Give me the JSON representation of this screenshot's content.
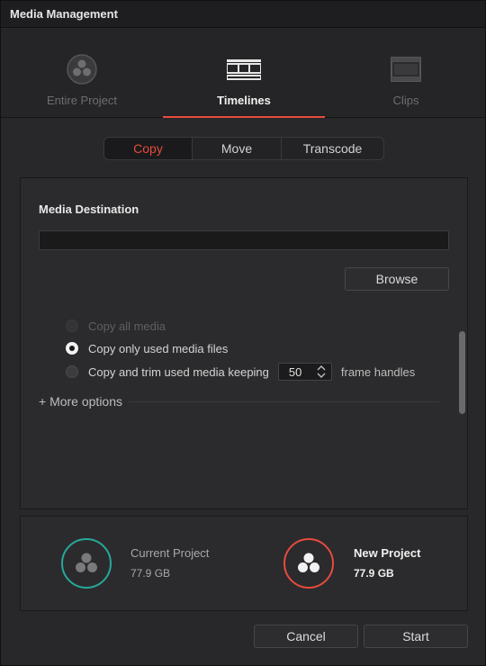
{
  "window": {
    "title": "Media Management"
  },
  "modes": [
    {
      "label": "Entire Project",
      "icon": "resolve-logo-icon",
      "active": false
    },
    {
      "label": "Timelines",
      "icon": "timeline-icon",
      "active": true
    },
    {
      "label": "Clips",
      "icon": "film-strip-icon",
      "active": false
    }
  ],
  "operations": [
    {
      "label": "Copy",
      "active": true
    },
    {
      "label": "Move",
      "active": false
    },
    {
      "label": "Transcode",
      "active": false
    }
  ],
  "destination": {
    "title": "Media Destination",
    "value": "",
    "browse_label": "Browse"
  },
  "options": {
    "copy_all": {
      "label": "Copy all media",
      "enabled": false,
      "checked": false
    },
    "copy_used": {
      "label": "Copy only used media files",
      "enabled": true,
      "checked": true
    },
    "copy_trim": {
      "label": "Copy and trim used media keeping",
      "enabled": true,
      "checked": false,
      "handles_value": "50",
      "suffix": "frame handles"
    },
    "more_options": "+ More options"
  },
  "summary": {
    "current": {
      "label": "Current Project",
      "size": "77.9 GB",
      "color": "#27a89a"
    },
    "new": {
      "label": "New Project",
      "size": "77.9 GB",
      "color": "#e64b3c"
    }
  },
  "footer": {
    "cancel_label": "Cancel",
    "start_label": "Start"
  },
  "colors": {
    "accent": "#e64b3c",
    "teal": "#27a89a"
  }
}
